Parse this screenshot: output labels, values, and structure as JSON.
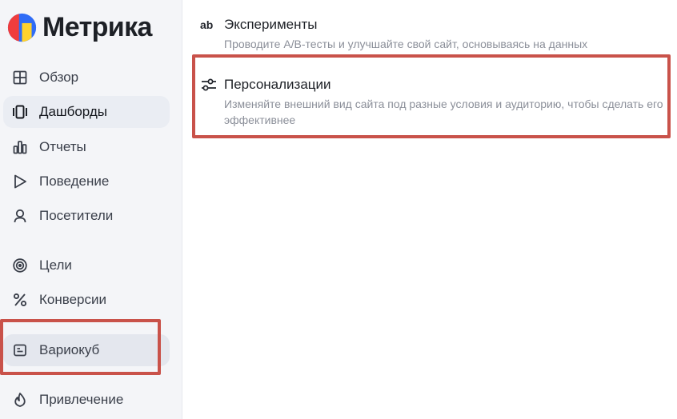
{
  "app": {
    "logo_text": "Метрика",
    "accent_highlight": "#c9524a"
  },
  "sidebar": {
    "items": [
      {
        "label": "Обзор",
        "icon": "grid-icon"
      },
      {
        "label": "Дашборды",
        "icon": "dashboard-icon",
        "active": true
      },
      {
        "label": "Отчеты",
        "icon": "bar-chart-icon"
      },
      {
        "label": "Поведение",
        "icon": "play-icon"
      },
      {
        "label": "Посетители",
        "icon": "user-icon"
      },
      {
        "label": "Цели",
        "icon": "target-icon"
      },
      {
        "label": "Конверсии",
        "icon": "percent-icon"
      },
      {
        "label": "Вариокуб",
        "icon": "variocube-icon",
        "highlighted": true
      },
      {
        "label": "Привлечение",
        "icon": "fire-icon"
      }
    ]
  },
  "main": {
    "items": [
      {
        "title": "Эксперименты",
        "description": "Проводите А/В-тесты и улучшайте свой сайт, основываясь на данных",
        "icon": "ab-icon"
      },
      {
        "title": "Персонализации",
        "description": "Изменяйте внешний вид сайта под разные условия и аудиторию, чтобы сделать его эффективнее",
        "icon": "sliders-icon",
        "highlighted": true
      }
    ]
  }
}
